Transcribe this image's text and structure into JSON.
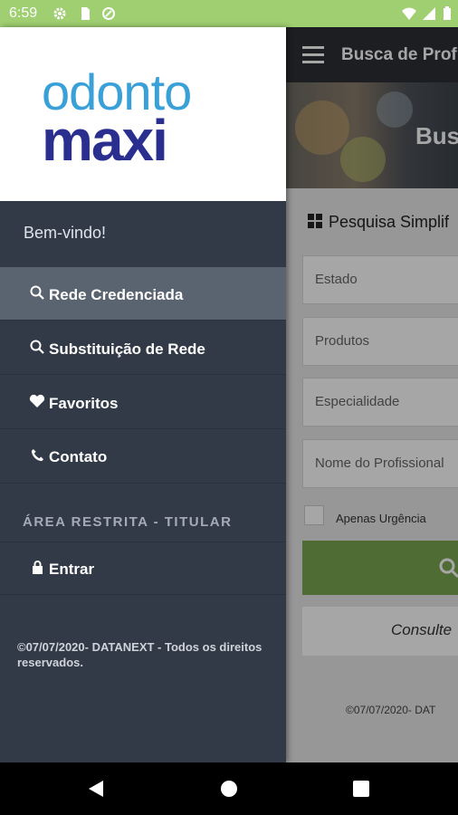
{
  "status_bar": {
    "time": "6:59"
  },
  "app": {
    "title": "Busca de Profi",
    "banner_text": "Bus",
    "search_title": "Pesquisa Simplif",
    "fields": [
      {
        "label": "Estado"
      },
      {
        "label": "Produtos"
      },
      {
        "label": "Especialidade"
      },
      {
        "placeholder": "Nome do Profissional"
      }
    ],
    "urgency_label": "Apenas Urgência",
    "consulte_label": "Consulte",
    "footer": "©07/07/2020- DAT"
  },
  "drawer": {
    "logo_top": "odonto",
    "logo_bottom": "maxi",
    "welcome": "Bem-vindo!",
    "items": [
      {
        "label": "Rede Credenciada",
        "icon": "search-icon",
        "active": true
      },
      {
        "label": "Substituição de Rede",
        "icon": "search-icon"
      },
      {
        "label": "Favoritos",
        "icon": "heart-icon"
      },
      {
        "label": "Contato",
        "icon": "phone-icon"
      }
    ],
    "section_restricted": "ÁREA RESTRITA - TITULAR",
    "login": {
      "label": "Entrar",
      "icon": "lock-icon"
    },
    "footer": "©07/07/2020- DATANEXT - Todos os direitos reservados."
  },
  "colors": {
    "status_bar": "#9fcf71",
    "drawer_bg": "#323a47",
    "active_item": "#5a6370",
    "search_button": "#7aa750",
    "logo_blue": "#3aa0d8",
    "logo_navy": "#2a2e8f"
  }
}
